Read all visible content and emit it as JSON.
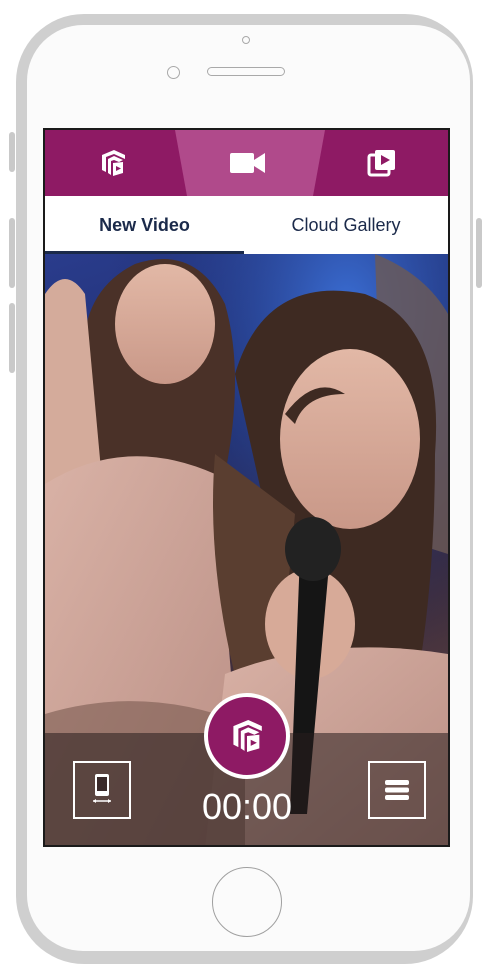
{
  "top_tabs": [
    {
      "icon": "logo-cube-icon",
      "active": false
    },
    {
      "icon": "video-camera-icon",
      "active": true
    },
    {
      "icon": "play-gallery-icon",
      "active": false
    }
  ],
  "sub_tabs": [
    {
      "label": "New Video",
      "active": true
    },
    {
      "label": "Cloud Gallery",
      "active": false
    }
  ],
  "recorder": {
    "timer": "00:00",
    "record_icon": "logo-cube-icon",
    "switch_camera_icon": "switch-camera-icon",
    "menu_icon": "hamburger-menu-icon"
  },
  "colors": {
    "brand": "#8e1a64",
    "active_tab": "#b04a8b",
    "subtab_text": "#1b2a4a"
  }
}
